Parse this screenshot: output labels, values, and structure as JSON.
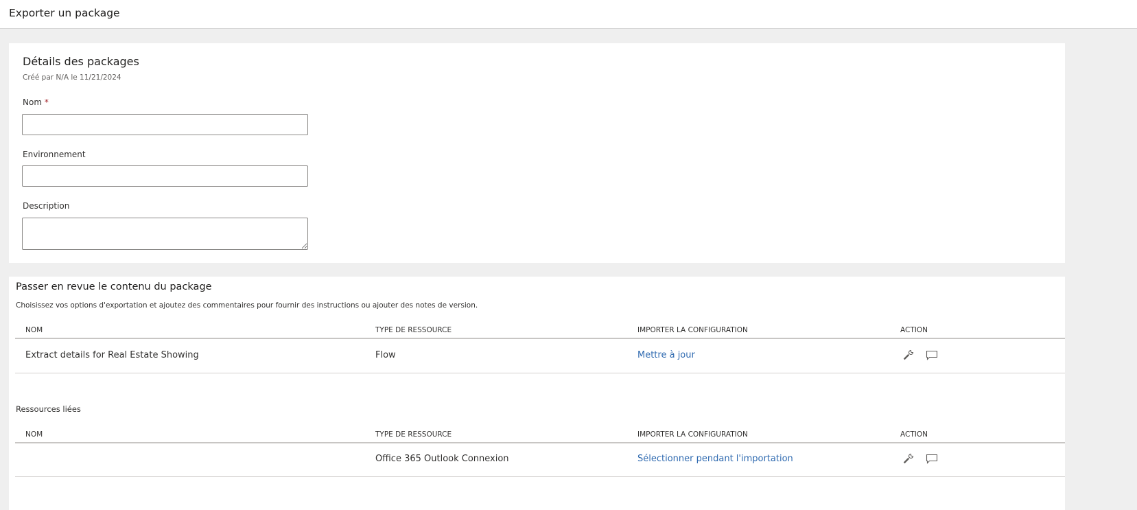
{
  "header": {
    "title": "Exporter un package"
  },
  "details": {
    "title": "Détails des packages",
    "subtitle": "Créé par N/A le 11/21/2024",
    "name_label": "Nom",
    "required_mark": "*",
    "name_value": "",
    "env_label": "Environnement",
    "env_value": "",
    "desc_label": "Description",
    "desc_value": ""
  },
  "review": {
    "title": "Passer en revue le contenu du package",
    "subtitle": "Choisissez vos options d'exportation et ajoutez des commentaires pour fournir des instructions ou ajouter des notes de version.",
    "columns": [
      "NOM",
      "TYPE DE RESSOURCE",
      "IMPORTER LA CONFIGURATION",
      "ACTION"
    ],
    "rows": [
      {
        "name": "Extract details for Real Estate Showing",
        "type": "Flow",
        "config": "Mettre à jour"
      }
    ],
    "related_title": "Ressources liées",
    "related_rows": [
      {
        "name": "",
        "type": "Office 365 Outlook Connexion",
        "config": "Sélectionner pendant l'importation"
      }
    ]
  },
  "icons": {
    "settings": "wrench-icon",
    "comment": "comment-icon"
  }
}
